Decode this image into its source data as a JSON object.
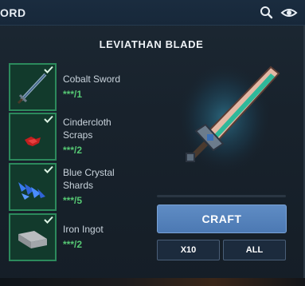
{
  "window": {
    "title": "ORD"
  },
  "recipe": {
    "name": "LEVIATHAN BLADE"
  },
  "ingredients": [
    {
      "name_line1": "Cobalt Sword",
      "name_line2": "",
      "count": "***/1",
      "icon": "sword-icon"
    },
    {
      "name_line1": "Cindercloth",
      "name_line2": "Scraps",
      "count": "***/2",
      "icon": "cloth-icon"
    },
    {
      "name_line1": "Blue Crystal",
      "name_line2": "Shards",
      "count": "***/5",
      "icon": "crystal-icon"
    },
    {
      "name_line1": "Iron Ingot",
      "name_line2": "",
      "count": "***/2",
      "icon": "ingot-icon"
    }
  ],
  "actions": {
    "craft_label": "CRAFT",
    "x10_label": "X10",
    "all_label": "ALL"
  },
  "colors": {
    "accent": "#5f8cc4",
    "owned_green": "#56c974",
    "slot_border": "#2c8a5c"
  }
}
